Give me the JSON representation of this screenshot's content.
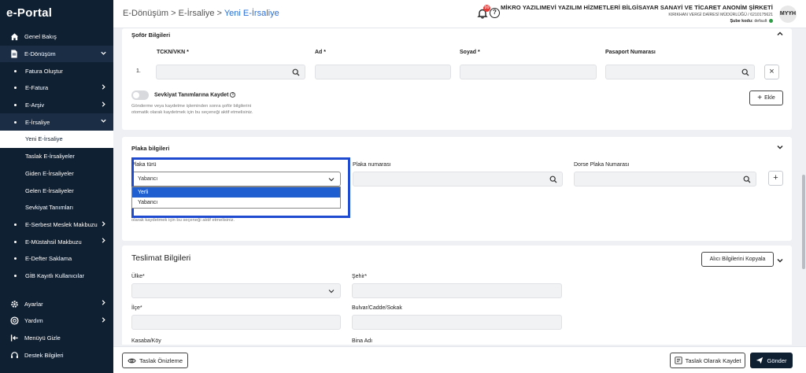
{
  "app": {
    "logo": "e-Portal"
  },
  "sidebar": {
    "items": [
      {
        "label": "Genel Bakış",
        "icon": "home-icon"
      },
      {
        "label": "E-Dönüşüm",
        "icon": "document-icon"
      },
      {
        "label": "Fatura Oluştur"
      },
      {
        "label": "E-Fatura"
      },
      {
        "label": "E-Arşiv"
      },
      {
        "label": "E-İrsaliye"
      },
      {
        "label": "Yeni E-İrsaliye"
      },
      {
        "label": "Taslak E-İrsaliyeler"
      },
      {
        "label": "Giden E-İrsaliyeler"
      },
      {
        "label": "Gelen E-İrsaliyeler"
      },
      {
        "label": "Sevkiyat Tanımları"
      },
      {
        "label": "E-Serbest Meslek Makbuzu"
      },
      {
        "label": "E-Müstahsil Makbuzu"
      },
      {
        "label": "E-Defter Saklama"
      },
      {
        "label": "GİB Kayıtlı Kullanıcılar"
      },
      {
        "label": "Ayarlar",
        "icon": "gear-icon"
      },
      {
        "label": "Yardım",
        "icon": "lifebuoy-icon"
      },
      {
        "label": "Menüyü Gizle",
        "icon": "collapse-icon"
      },
      {
        "label": "Destek Bilgileri",
        "icon": "headset-icon"
      }
    ]
  },
  "header": {
    "breadcrumb": {
      "part1": "E-Dönüşüm",
      "sep": " > ",
      "part2": "E-İrsaliye",
      "current": "Yeni E-İrsaliye"
    },
    "notification_count": "99",
    "company_name": "MİKRO YAZILIMEVİ YAZILIM HİZMETLERİ BİLGİSAYAR SANAYİ VE TİCARET ANONİM ŞİRKETİ",
    "tax_info": "KIRIKHAN VERGİ DAİRESİ MÜDÜRLÜĞÜ / 6210175621",
    "branch_label": "Şube kodu:",
    "branch_value": "default",
    "avatar": "MYYH"
  },
  "driver": {
    "title": "Şoför Bilgileri",
    "col_tckn": "TCKN/VKN *",
    "col_ad": "Ad *",
    "col_soyad": "Soyad *",
    "col_pasaport": "Pasaport Numarası",
    "row_index": "1.",
    "remove_label": "×",
    "toggle_label": "Sevkiyat Tanımlarına Kaydet",
    "hint1": "Gönderme veya kaydetme işleminden sonra şoför bilgilerini",
    "hint2": "otomatik olarak kaydetmek için bu seçeneği aktif etmelisiniz.",
    "add_label": "Ekle"
  },
  "plate": {
    "title": "Plaka bilgileri",
    "type_label": "Plaka türü",
    "type_value": "Yabancı",
    "number_label": "Plaka numarası",
    "trailer_label": "Dorse Plaka Numarası",
    "options": [
      "Yerli",
      "Yabancı"
    ],
    "hint2": "olarak kaydetmek için bu seçeneği aktif etmelisiniz."
  },
  "delivery": {
    "title": "Teslimat Bilgileri",
    "copy_label": "Alıcı Bilgilerini Kopyala",
    "country": "Ülke*",
    "city": "Şehir*",
    "district": "İlçe*",
    "street": "Bulvar/Cadde/Sokak",
    "town": "Kasaba/Köy",
    "building": "Bina Adı"
  },
  "footer": {
    "preview_label": "Taslak Önizleme",
    "save_draft_label": "Taslak Olarak Kaydet",
    "send_label": "Gönder"
  }
}
